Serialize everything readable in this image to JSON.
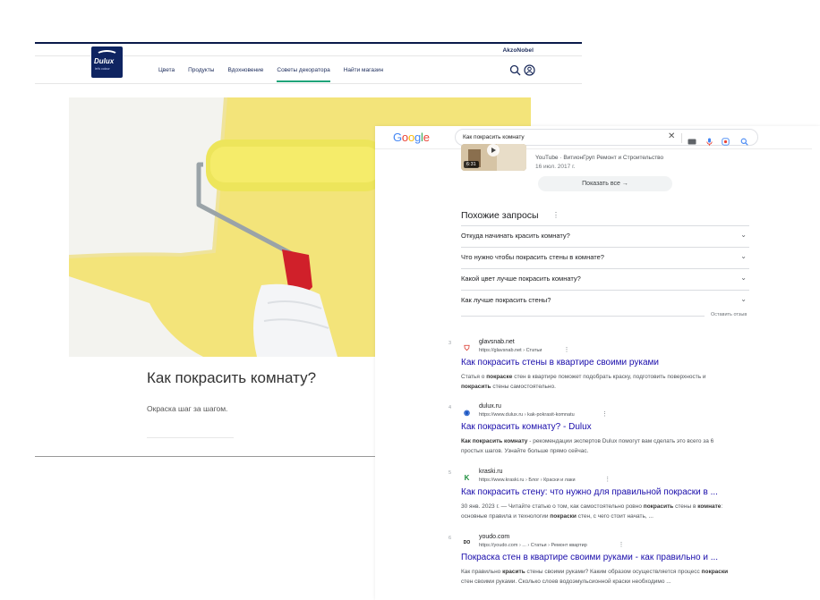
{
  "dulux": {
    "brand_top": "AkzoNobel",
    "logo_word": "Dulux",
    "logo_tag": "let's colour",
    "nav": [
      {
        "label": "Цвета"
      },
      {
        "label": "Продукты"
      },
      {
        "label": "Вдохновение"
      },
      {
        "label": "Советы декоратора",
        "active": true
      },
      {
        "label": "Найти магазин"
      }
    ],
    "article_title": "Как покрасить комнату?",
    "article_subtitle": "Окраска шаг за шагом."
  },
  "google": {
    "logo": "Google",
    "query": "Как покрасить комнату",
    "video": {
      "duration": "6:31",
      "source_line": "YouTube · ВитионГруп Ремонт и Строительство",
      "date": "16 июл. 2017 г."
    },
    "show_all_label": "Показать все",
    "related": {
      "title": "Похожие запросы",
      "items": [
        "Откуда начинать красить комнату?",
        "Что нужно чтобы покрасить стены в комнате?",
        "Какой цвет лучше покрасить комнату?",
        "Как лучше покрасить стены?"
      ],
      "feedback": "Оставить отзыв"
    },
    "results": [
      {
        "num": "3",
        "site": "glavsnab.net",
        "url": "https://glavsnab.net › Статьи",
        "title": "Как покрасить стены в квартире своими руками",
        "snippet_html": "Статья о <b>покраске</b> стен в квартире поможет подобрать краску, подготовить поверхность и <b>покрасить</b> стены самостоятельно.",
        "fav_text": "⛉",
        "fav_color": "#d93025"
      },
      {
        "num": "4",
        "site": "dulux.ru",
        "url": "https://www.dulux.ru › kak-pokrasit-komnatu",
        "title": "Как покрасить комнату? - Dulux",
        "snippet_html": "<b>Как покрасить комнату</b> - рекомендации экспертов Dulux помогут вам сделать это всего за 6 простых шагов. Узнайте больше прямо сейчас.",
        "fav_text": "◉",
        "fav_color": "#1a56c4"
      },
      {
        "num": "5",
        "site": "kraski.ru",
        "url": "https://www.kraski.ru › Блог › Краски и лаки",
        "title": "Как покрасить стену: что нужно для правильной покраски в ...",
        "snippet_html": "30 янв. 2023 г. — Читайте статью о том, как самостоятельно ровно <b>покрасить</b> стены в <b>комнате</b>: основные правила и технологии <b>покраски</b> стен, с чего стоит начать, ...",
        "fav_text": "K",
        "fav_color": "#1e8e3e"
      },
      {
        "num": "6",
        "site": "youdo.com",
        "url": "https://youdo.com › ... › Статьи › Ремонт квартир",
        "title": "Покраска стен в квартире своими руками - как правильно и ...",
        "snippet_html": "Как правильно <b>красить</b> стены своими руками? Каким образом осуществляется процесс <b>покраски</b> стен своими руками. Сколько слоев водоэмульсионной краски необходимо ...",
        "fav_text": "DO",
        "fav_color": "#111111"
      }
    ]
  }
}
